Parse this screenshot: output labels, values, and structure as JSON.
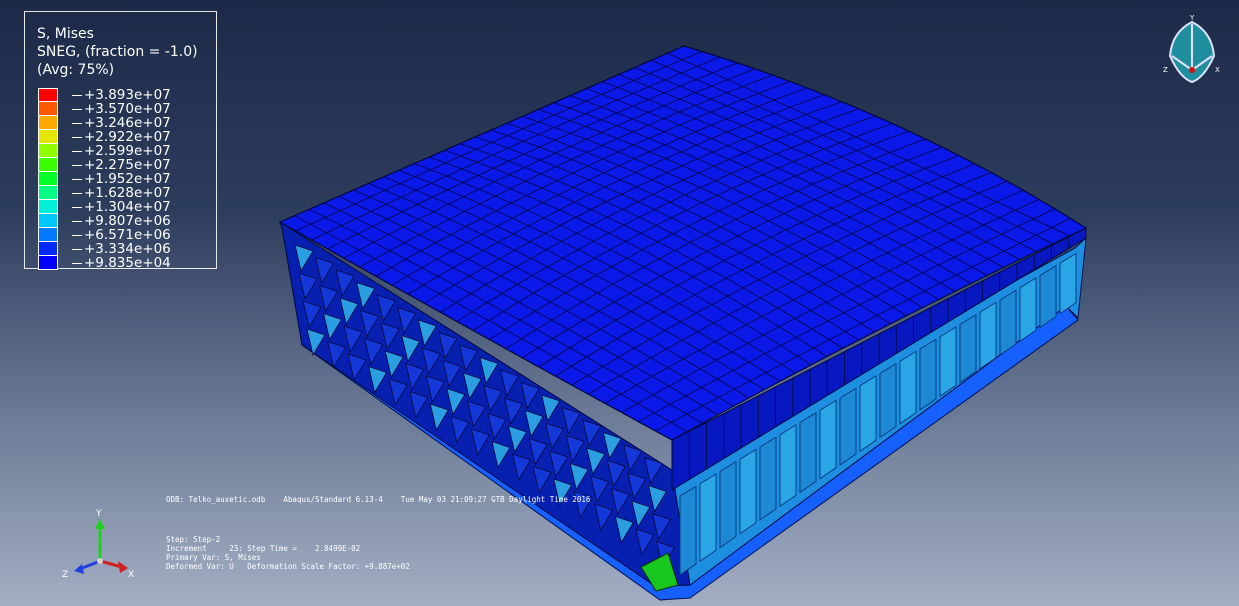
{
  "legend": {
    "title": "S, Mises",
    "subtitle": "SNEG, (fraction = -1.0)",
    "average": "(Avg: 75%)",
    "values": [
      "+3.893e+07",
      "+3.570e+07",
      "+3.246e+07",
      "+2.922e+07",
      "+2.599e+07",
      "+2.275e+07",
      "+1.952e+07",
      "+1.628e+07",
      "+1.304e+07",
      "+9.807e+06",
      "+6.571e+06",
      "+3.334e+06",
      "+9.835e+04"
    ],
    "colors": [
      "#ff0000",
      "#ff5a00",
      "#ffaa00",
      "#e5e600",
      "#8fff00",
      "#39ff00",
      "#00ff28",
      "#00ff82",
      "#00f0d7",
      "#00c8ff",
      "#0078ff",
      "#0028ff",
      "#0000ff"
    ]
  },
  "info": {
    "odb_line": "ODB: Telko_auxetic.odb    Abaqus/Standard 6.13-4    Tue May 03 21:09:27 GTB Daylight Time 2016",
    "step_line": "Step: Step-2",
    "increment_line": "Increment     23: Step Time =    2.8499E-02",
    "primary_var_line": "Primary Var: S, Mises",
    "deformed_var_line": "Deformed Var: U   Deformation Scale Factor: +9.887e+02"
  },
  "triad": {
    "x_label": "X",
    "y_label": "Y",
    "z_label": "Z"
  },
  "view_cube": {
    "x_label": "X",
    "y_label": "Y",
    "z_label": "Z"
  }
}
